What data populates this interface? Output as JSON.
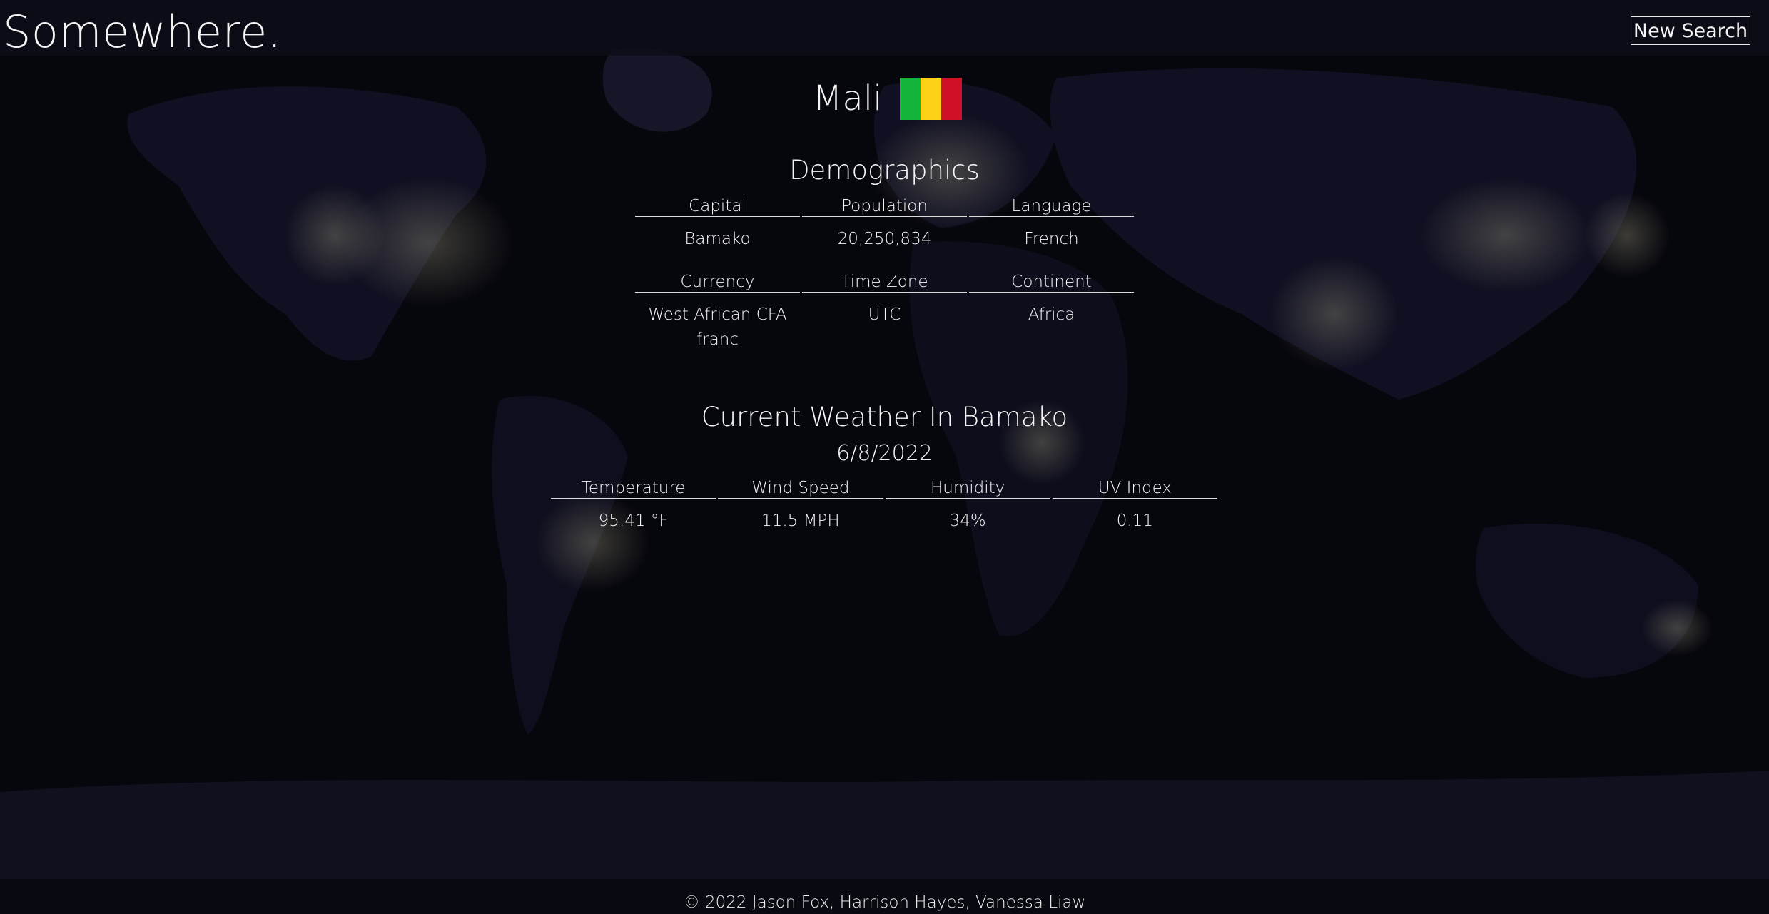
{
  "app": {
    "brand": "Somewhere.",
    "new_search_label": "New Search"
  },
  "country": {
    "name": "Mali",
    "flag_colors": [
      "#14b53a",
      "#fcd116",
      "#ce1126"
    ]
  },
  "demographics": {
    "title": "Demographics",
    "row1": {
      "headers": [
        "Capital",
        "Population",
        "Language"
      ],
      "values": [
        "Bamako",
        "20,250,834",
        "French"
      ]
    },
    "row2": {
      "headers": [
        "Currency",
        "Time Zone",
        "Continent"
      ],
      "values": [
        "West African CFA franc",
        "UTC",
        "Africa"
      ]
    }
  },
  "weather": {
    "title": "Current Weather In Bamako",
    "date": "6/8/2022",
    "headers": [
      "Temperature",
      "Wind Speed",
      "Humidity",
      "UV Index"
    ],
    "values": [
      "95.41 °F",
      "11.5 MPH",
      "34%",
      "0.11"
    ]
  },
  "footer": {
    "text": "© 2022 Jason Fox, Harrison Hayes, Vanessa Liaw"
  },
  "colors": {
    "background": "#06060d",
    "text": "#f4f4f4"
  }
}
